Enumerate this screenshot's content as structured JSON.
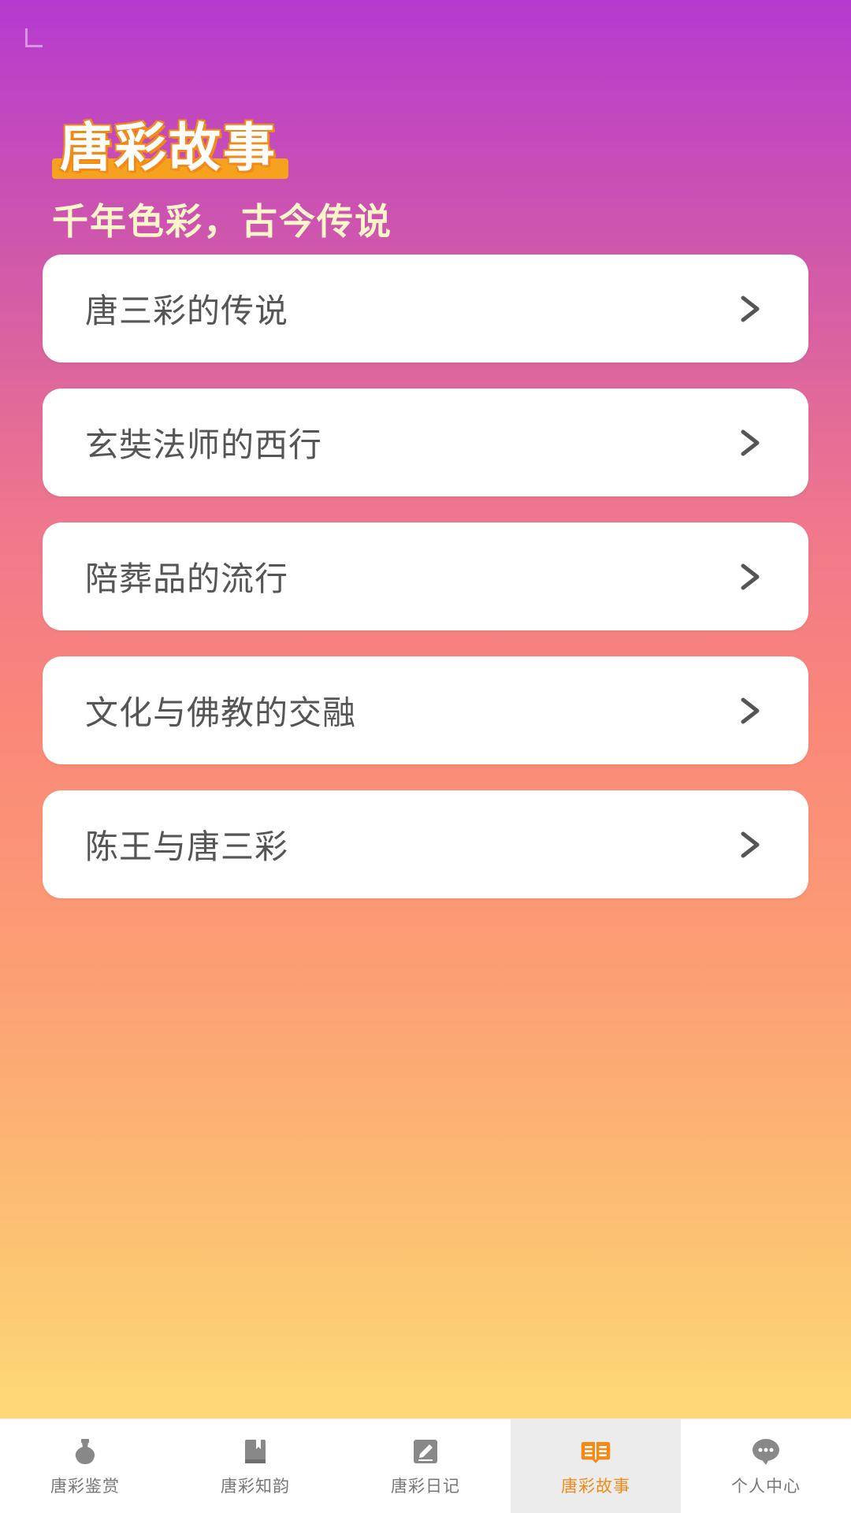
{
  "header": {
    "title": "唐彩故事",
    "subtitle": "千年色彩，古今传说"
  },
  "stories": [
    {
      "label": "唐三彩的传说"
    },
    {
      "label": "玄奘法师的西行"
    },
    {
      "label": "陪葬品的流行"
    },
    {
      "label": "文化与佛教的交融"
    },
    {
      "label": "陈王与唐三彩"
    }
  ],
  "nav": {
    "items": [
      {
        "label": "唐彩鉴赏",
        "icon": "vase-icon"
      },
      {
        "label": "唐彩知韵",
        "icon": "book-icon"
      },
      {
        "label": "唐彩日记",
        "icon": "edit-note-icon"
      },
      {
        "label": "唐彩故事",
        "icon": "open-book-icon"
      },
      {
        "label": "个人中心",
        "icon": "chat-bubble-icon"
      }
    ],
    "active_index": 3
  },
  "colors": {
    "accent": "#f28a18",
    "gradient_top": "#b53ad0",
    "gradient_bottom": "#fde080",
    "icon_inactive": "#888888"
  }
}
